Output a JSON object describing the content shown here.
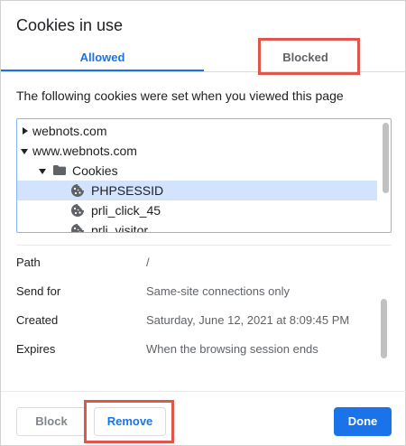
{
  "dialog": {
    "title": "Cookies in use",
    "tabs": [
      {
        "label": "Allowed",
        "active": true
      },
      {
        "label": "Blocked",
        "active": false
      }
    ],
    "description": "The following cookies were set when you viewed this page"
  },
  "tree": {
    "rows": [
      {
        "label": "webnots.com",
        "expander": "collapsed",
        "icon": "none"
      },
      {
        "label": "www.webnots.com",
        "expander": "expanded",
        "icon": "none"
      },
      {
        "label": "Cookies",
        "expander": "expanded",
        "icon": "folder-icon"
      },
      {
        "label": "PHPSESSID",
        "icon": "cookie-icon",
        "selected": true
      },
      {
        "label": "prli_click_45",
        "icon": "cookie-icon"
      },
      {
        "label": "prli_visitor",
        "icon": "cookie-icon"
      }
    ]
  },
  "details": [
    {
      "key": "Path",
      "value": "/"
    },
    {
      "key": "Send for",
      "value": "Same-site connections only"
    },
    {
      "key": "Created",
      "value": "Saturday, June 12, 2021 at 8:09:45 PM"
    },
    {
      "key": "Expires",
      "value": "When the browsing session ends"
    }
  ],
  "buttons": {
    "block": "Block",
    "remove": "Remove",
    "done": "Done"
  },
  "colors": {
    "accent": "#1a73e8",
    "highlight": "#e0564b",
    "selected_row": "#d3e3fd"
  }
}
